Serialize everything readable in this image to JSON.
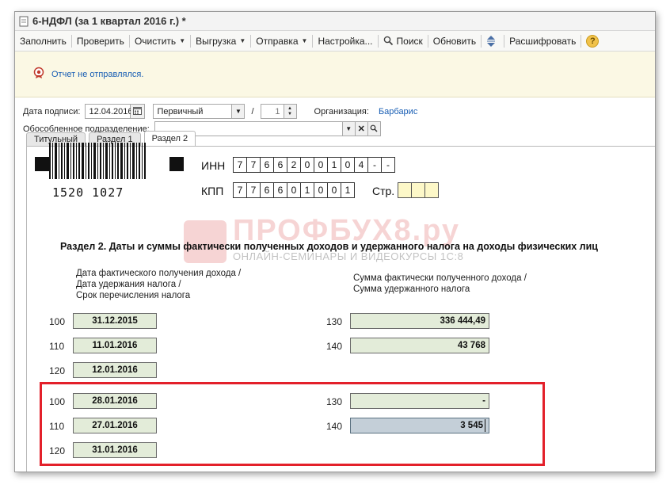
{
  "window": {
    "title": "6-НДФЛ (за 1 квартал 2016 г.) *"
  },
  "toolbar": {
    "fill": "Заполнить",
    "check": "Проверить",
    "clear": "Очистить",
    "export": "Выгрузка",
    "send": "Отправка",
    "settings": "Настройка...",
    "search": "Поиск",
    "refresh": "Обновить",
    "decode": "Расшифровать",
    "help": "?"
  },
  "notice": {
    "text": "Отчет не отправлялся."
  },
  "form_header": {
    "sign_date_label": "Дата подписи:",
    "sign_date": "12.04.2016",
    "type": "Первичный",
    "separator": "/",
    "correction_number": "1",
    "org_label": "Организация:",
    "org_name": "Барбарис",
    "division_label": "Обособленное подразделение:",
    "division_value": ""
  },
  "tabs": [
    {
      "label": "Титульный",
      "active": false
    },
    {
      "label": "Раздел 1",
      "active": false
    },
    {
      "label": "Раздел 2",
      "active": true
    }
  ],
  "report": {
    "barcode_number": "1520 1027",
    "inn_label": "ИНН",
    "inn_cells": [
      "7",
      "7",
      "6",
      "6",
      "2",
      "0",
      "0",
      "1",
      "0",
      "4",
      "-",
      "-"
    ],
    "kpp_label": "КПП",
    "kpp_cells": [
      "7",
      "7",
      "6",
      "6",
      "0",
      "1",
      "0",
      "0",
      "1"
    ],
    "page_label": "Стр.",
    "page_cells": [
      "",
      "",
      ""
    ],
    "watermark_title": "ПРОФБУХ8.ру",
    "watermark_subtitle": "ОНЛАЙН-СЕМИНАРЫ И ВИДЕОКУРСЫ 1С:8",
    "section_title": "Раздел 2.  Даты и суммы фактически полученных доходов и удержанного налога на доходы физических лиц",
    "left_header": [
      "Дата фактического получения дохода /",
      "Дата удержания налога /",
      "Срок перечисления налога"
    ],
    "right_header": [
      "Сумма фактически полученного дохода /",
      "Сумма удержанного налога"
    ],
    "blocks": [
      {
        "dates": [
          {
            "code": "100",
            "value": "31.12.2015"
          },
          {
            "code": "110",
            "value": "11.01.2016"
          },
          {
            "code": "120",
            "value": "12.01.2016"
          }
        ],
        "sums": [
          {
            "code": "130",
            "value": "336 444,49"
          },
          {
            "code": "140",
            "value": "43 768"
          }
        ]
      },
      {
        "dates": [
          {
            "code": "100",
            "value": "28.01.2016"
          },
          {
            "code": "110",
            "value": "27.01.2016"
          },
          {
            "code": "120",
            "value": "31.01.2016"
          }
        ],
        "sums": [
          {
            "code": "130",
            "value": "-"
          },
          {
            "code": "140",
            "value": "3 545"
          }
        ]
      }
    ]
  },
  "colors": {
    "accent_link": "#1a5fb4",
    "field_fill": "#e3ecd9",
    "highlight_border": "#e3202a",
    "notice_bg": "#fbf8e4"
  }
}
